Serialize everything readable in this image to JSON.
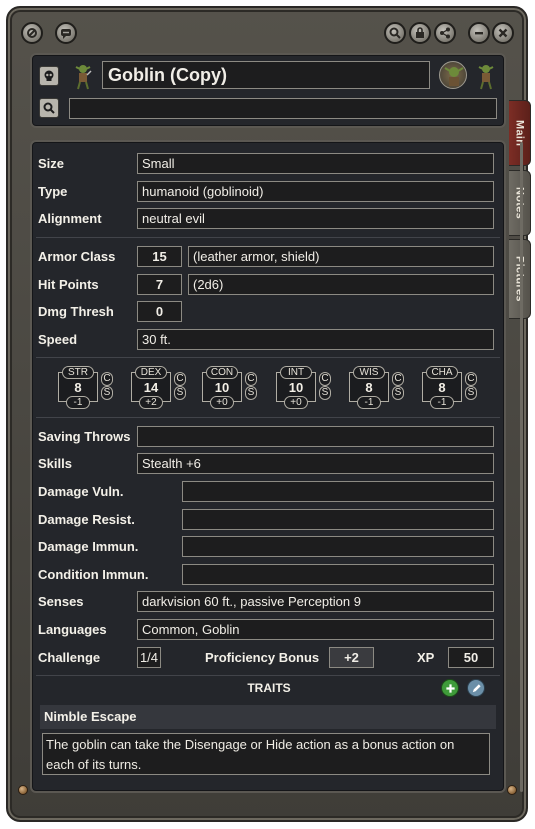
{
  "window": {
    "buttons": [
      "link-icon",
      "chat-icon",
      "search-icon",
      "lock-icon",
      "share-icon",
      "minimize-icon",
      "close-icon"
    ]
  },
  "header": {
    "name": "Goblin (Copy)",
    "nonid_name": ""
  },
  "tabs": [
    {
      "label": "Main",
      "active": true
    },
    {
      "label": "Notes",
      "active": false
    },
    {
      "label": "Pictures",
      "active": false
    }
  ],
  "stats": {
    "size_label": "Size",
    "size": "Small",
    "type_label": "Type",
    "type": "humanoid (goblinoid)",
    "alignment_label": "Alignment",
    "alignment": "neutral evil",
    "ac_label": "Armor Class",
    "ac": "15",
    "ac_text": "(leather armor, shield)",
    "hp_label": "Hit Points",
    "hp": "7",
    "hp_text": "(2d6)",
    "dt_label": "Dmg Thresh",
    "dt": "0",
    "speed_label": "Speed",
    "speed": "30 ft."
  },
  "abilities": [
    {
      "abbr": "STR",
      "score": "8",
      "mod": "-1"
    },
    {
      "abbr": "DEX",
      "score": "14",
      "mod": "+2"
    },
    {
      "abbr": "CON",
      "score": "10",
      "mod": "+0"
    },
    {
      "abbr": "INT",
      "score": "10",
      "mod": "+0"
    },
    {
      "abbr": "WIS",
      "score": "8",
      "mod": "-1"
    },
    {
      "abbr": "CHA",
      "score": "8",
      "mod": "-1"
    }
  ],
  "cs": {
    "c": "C",
    "s": "S"
  },
  "details": {
    "saves_label": "Saving Throws",
    "saves": "",
    "skills_label": "Skills",
    "skills": "Stealth +6",
    "vuln_label": "Damage Vuln.",
    "vuln": "",
    "resist_label": "Damage Resist.",
    "resist": "",
    "immun_label": "Damage Immun.",
    "immun": "",
    "cond_label": "Condition Immun.",
    "cond": "",
    "senses_label": "Senses",
    "senses": "darkvision 60 ft., passive Perception 9",
    "languages_label": "Languages",
    "languages": "Common, Goblin",
    "challenge_label": "Challenge",
    "challenge": "1/4",
    "prof_label": "Proficiency Bonus",
    "prof": "+2",
    "xp_label": "XP",
    "xp": "50"
  },
  "traits": {
    "header": "TRAITS",
    "items": [
      {
        "name": "Nimble Escape",
        "desc": "The goblin can take the Disengage or Hide action as a bonus action on each of its turns."
      }
    ]
  },
  "colors": {
    "accent_tab": "#7c2d25",
    "add_button": "#3f9b3a",
    "edit_button": "#6b8fa8"
  }
}
